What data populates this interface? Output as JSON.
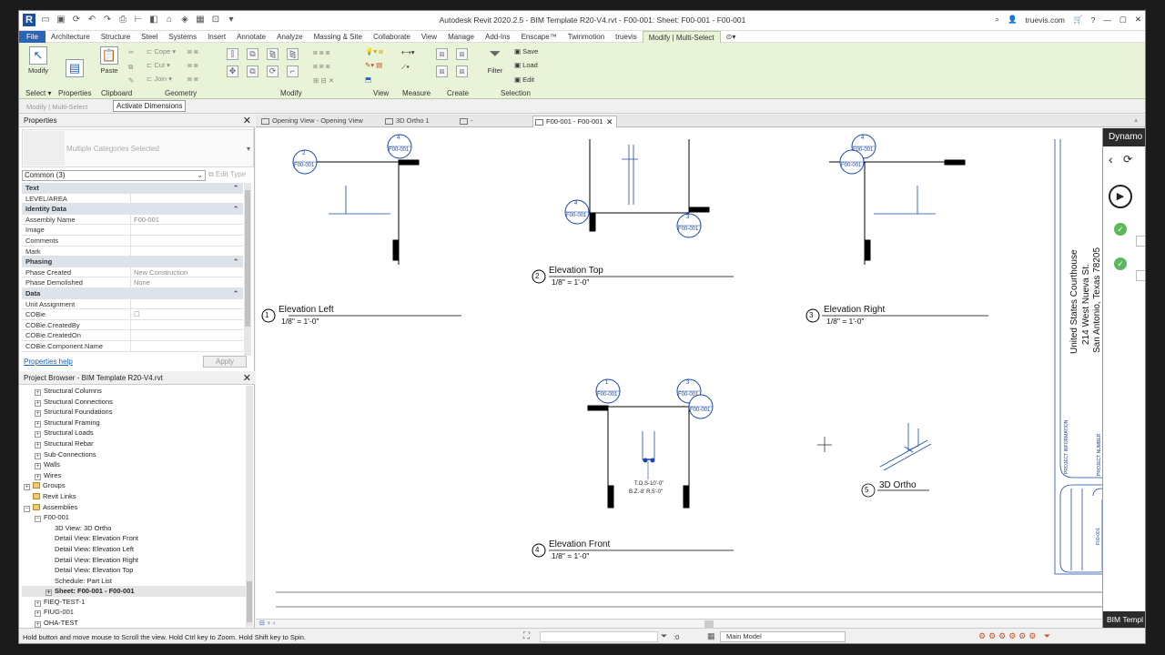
{
  "title_bar": {
    "title": "Autodesk Revit 2020.2.5 - BIM Template R20-V4.rvt - F00-001: Sheet: F00-001 - F00-001",
    "user": "truevis.com"
  },
  "menu_tabs": [
    "File",
    "Architecture",
    "Structure",
    "Steel",
    "Systems",
    "Insert",
    "Annotate",
    "Analyze",
    "Massing & Site",
    "Collaborate",
    "View",
    "Manage",
    "Add-Ins",
    "Enscape™",
    "Twinmotion",
    "truevis",
    "Modify | Multi-Select"
  ],
  "ribbon": {
    "modify_label": "Modify",
    "paste_label": "Paste",
    "filter_label": "Filter",
    "cope_label": "Cope",
    "cut_label": "Cut",
    "join_label": "Join",
    "save_label": "Save",
    "load_label": "Load",
    "edit_label": "Edit",
    "panels": [
      "Select",
      "Properties",
      "Clipboard",
      "Geometry",
      "Modify",
      "View",
      "Measure",
      "Create",
      "Selection"
    ]
  },
  "options_bar": {
    "context": "Modify | Multi-Select",
    "activate_dimensions": "Activate Dimensions"
  },
  "properties": {
    "header": "Properties",
    "type_selector": "Multiple Categories Selected",
    "instance_selector": "Common (3)",
    "edit_type": "Edit Type",
    "help": "Properties help",
    "apply": "Apply",
    "rows": [
      {
        "group": true,
        "label": "Text"
      },
      {
        "label": "LEVEL/AREA",
        "value": ""
      },
      {
        "group": true,
        "label": "Identity Data"
      },
      {
        "label": "Assembly Name",
        "value": "F00-001"
      },
      {
        "label": "Image",
        "value": ""
      },
      {
        "label": "Comments",
        "value": ""
      },
      {
        "label": "Mark",
        "value": ""
      },
      {
        "group": true,
        "label": "Phasing"
      },
      {
        "label": "Phase Created",
        "value": "New Construction"
      },
      {
        "label": "Phase Demolished",
        "value": "None"
      },
      {
        "group": true,
        "label": "Data"
      },
      {
        "label": "Unit Assignment",
        "value": ""
      },
      {
        "label": "COBie",
        "value": "☐"
      },
      {
        "label": "COBie.CreatedBy",
        "value": ""
      },
      {
        "label": "COBie.CreatedOn",
        "value": ""
      },
      {
        "label": "COBie.Component.Name",
        "value": ""
      }
    ]
  },
  "project_browser": {
    "header": "Project Browser - BIM Template R20-V4.rvt",
    "items": [
      {
        "label": "Structural Columns",
        "indent": 1,
        "expander": "+"
      },
      {
        "label": "Structural Connections",
        "indent": 1,
        "expander": "+"
      },
      {
        "label": "Structural Foundations",
        "indent": 1,
        "expander": "+"
      },
      {
        "label": "Structural Framing",
        "indent": 1,
        "expander": "+"
      },
      {
        "label": "Structural Loads",
        "indent": 1,
        "expander": "+"
      },
      {
        "label": "Structural Rebar",
        "indent": 1,
        "expander": "+"
      },
      {
        "label": "Sub-Connections",
        "indent": 1,
        "expander": "+"
      },
      {
        "label": "Walls",
        "indent": 1,
        "expander": "+"
      },
      {
        "label": "Wires",
        "indent": 1,
        "expander": "+"
      },
      {
        "label": "Groups",
        "indent": 0,
        "expander": "+",
        "folder": true
      },
      {
        "label": "Revit Links",
        "indent": 0,
        "expander": "",
        "folder": true
      },
      {
        "label": "Assemblies",
        "indent": 0,
        "expander": "−",
        "folder": true
      },
      {
        "label": "F00-001",
        "indent": 1,
        "expander": "−"
      },
      {
        "label": "3D View: 3D Ortho",
        "indent": 2,
        "expander": ""
      },
      {
        "label": "Detail View: Elevation Front",
        "indent": 2,
        "expander": ""
      },
      {
        "label": "Detail View: Elevation Left",
        "indent": 2,
        "expander": ""
      },
      {
        "label": "Detail View: Elevation Right",
        "indent": 2,
        "expander": ""
      },
      {
        "label": "Detail View: Elevation Top",
        "indent": 2,
        "expander": ""
      },
      {
        "label": "Schedule: Part List",
        "indent": 2,
        "expander": ""
      },
      {
        "label": "Sheet: F00-001 - F00-001",
        "indent": 2,
        "expander": "+",
        "bold": true,
        "selected": true
      },
      {
        "label": "FIEQ-TEST-1",
        "indent": 1,
        "expander": "+"
      },
      {
        "label": "FIUG-001",
        "indent": 1,
        "expander": "+"
      },
      {
        "label": "OHA-TEST",
        "indent": 1,
        "expander": "+"
      }
    ]
  },
  "view_tabs": [
    {
      "label": "Opening View - Opening View",
      "active": false
    },
    {
      "label": "3D Ortho 1",
      "active": false
    },
    {
      "label": "-",
      "active": false
    },
    {
      "label": "F00-001 - F00-001",
      "active": true
    }
  ],
  "sheet": {
    "views": [
      {
        "num": "1",
        "title": "Elevation Left",
        "scale": "1/8\" = 1'-0\""
      },
      {
        "num": "2",
        "title": "Elevation Top",
        "scale": "1/8\" = 1'-0\""
      },
      {
        "num": "3",
        "title": "Elevation Right",
        "scale": "1/8\" = 1'-0\""
      },
      {
        "num": "4",
        "title": "Elevation Front",
        "scale": "1/8\" = 1'-0\""
      },
      {
        "num": "5",
        "title": "3D Ortho",
        "scale": ""
      }
    ],
    "tag_ref": "F00-001",
    "notes": [
      "T.O.S-10'-0\"",
      "B.Z.-8' R.5'-0\""
    ],
    "address": [
      "United States Courthouse",
      "214 West Nueva St.",
      "San Antonio, Texas 78205"
    ],
    "titleblock_project_info": "PROJECT INFORMATION",
    "titleblock_project_number": "PROJECT NUMBER",
    "titleblock_sheet_number": "F00-001"
  },
  "dynamo": {
    "title": "Dynamo",
    "footer": "BIM Templ"
  },
  "status": {
    "message": "Hold button and move mouse to Scroll the view. Hold Ctrl key to Zoom. Hold Shift key to Spin.",
    "zero": ":0",
    "model": "Main Model"
  }
}
